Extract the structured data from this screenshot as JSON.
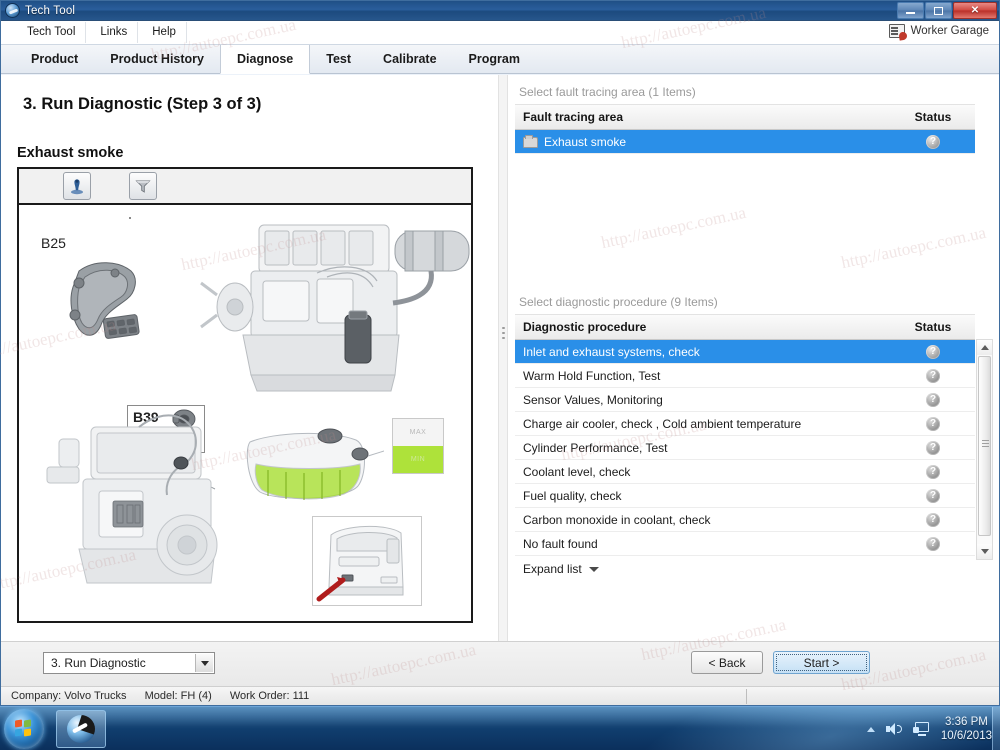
{
  "window": {
    "title": "Tech Tool",
    "icon": "tech-tool-icon",
    "minimize_label": "Minimize",
    "maximize_label": "Maximize",
    "close_label": "✕"
  },
  "menu": {
    "items": [
      {
        "label": "Tech Tool"
      },
      {
        "label": "Links"
      },
      {
        "label": "Help"
      }
    ],
    "garage": {
      "label": "Worker Garage",
      "icon": "worker-garage-icon"
    }
  },
  "tabs": [
    {
      "label": "Product",
      "active": false
    },
    {
      "label": "Product History",
      "active": false
    },
    {
      "label": "Diagnose",
      "active": true
    },
    {
      "label": "Test",
      "active": false
    },
    {
      "label": "Calibrate",
      "active": false
    },
    {
      "label": "Program",
      "active": false
    }
  ],
  "main": {
    "page_title": "3. Run Diagnostic (Step 3 of 3)",
    "illustration": {
      "heading": "Exhaust smoke",
      "toolbar": [
        {
          "icon": "info-icon",
          "name": "information-button"
        },
        {
          "icon": "funnel-icon",
          "name": "filter-button"
        }
      ],
      "labels": {
        "b25": "B25",
        "b39": "B39",
        "max": "MAX",
        "min": "MIN"
      }
    },
    "fault_tracing": {
      "section_label": "Select fault tracing area (1 Items)",
      "columns": [
        "Fault tracing area",
        "Status"
      ],
      "rows": [
        {
          "name": "Exhaust smoke",
          "status": "?",
          "selected": true,
          "icon": "folder-icon"
        }
      ]
    },
    "diagnostic_procedure": {
      "section_label": "Select diagnostic procedure (9 Items)",
      "columns": [
        "Diagnostic procedure",
        "Status"
      ],
      "rows": [
        {
          "name": "Inlet and exhaust systems, check",
          "status": "?",
          "selected": true
        },
        {
          "name": "Warm Hold Function, Test",
          "status": "?",
          "selected": false
        },
        {
          "name": "Sensor Values, Monitoring",
          "status": "?",
          "selected": false
        },
        {
          "name": "Charge air cooler, check , Cold ambient temperature",
          "status": "?",
          "selected": false
        },
        {
          "name": "Cylinder Performance, Test",
          "status": "?",
          "selected": false
        },
        {
          "name": "Coolant level, check",
          "status": "?",
          "selected": false
        },
        {
          "name": "Fuel quality, check",
          "status": "?",
          "selected": false
        },
        {
          "name": "Carbon monoxide in coolant, check",
          "status": "?",
          "selected": false
        },
        {
          "name": "No fault found",
          "status": "?",
          "selected": false
        }
      ],
      "expand_label": "Expand list"
    }
  },
  "footer": {
    "step_combo_value": "3. Run Diagnostic",
    "back_label": "< Back",
    "start_label": "Start >"
  },
  "statusbar": {
    "company": "Company: Volvo Trucks",
    "model": "Model: FH (4)",
    "work_order": "Work Order: 111"
  },
  "taskbar": {
    "start_label": "Start",
    "task_label": "Tech Tool",
    "time": "3:36 PM",
    "date": "10/6/2013"
  },
  "colors": {
    "selection_blue": "#2a8fe8",
    "titlebar_blue": "#2a5e9c",
    "close_red": "#cf4a42",
    "coolant_green": "#aee23a"
  },
  "watermark": {
    "texts": [
      "http://autoepc.com.ua",
      "http://autoepc.com.ua",
      "http://autoepc.com.ua",
      "http://autoepc.com.ua",
      "http://autoepc.com.ua",
      "http://autoepc.com.ua",
      "http://autoepc.com.ua",
      "http://autoepc.com.ua",
      "http://autoepc.com.ua",
      "http://autoepc.com.ua",
      "http://autoepc.com.ua",
      "http://autoepc.com.ua"
    ]
  }
}
